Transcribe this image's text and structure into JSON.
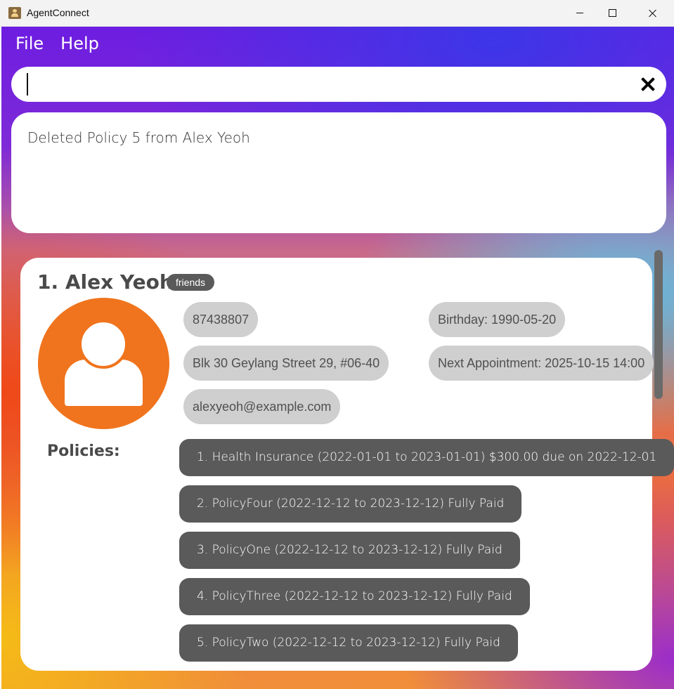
{
  "window": {
    "title": "AgentConnect",
    "icon": "address-book-icon"
  },
  "menu": {
    "items": [
      "File",
      "Help"
    ]
  },
  "command_box": {
    "value": "",
    "placeholder": ""
  },
  "result": {
    "text": "Deleted Policy 5 from Alex Yeoh"
  },
  "person": {
    "name": "1. Alex Yeoh",
    "tag": "friends",
    "phone": "87438807",
    "address": "Blk 30 Geylang Street 29, #06-40",
    "email": "alexyeoh@example.com",
    "birthday": "Birthday: 1990-05-20",
    "next_appointment": "Next Appointment: 2025-10-15 14:00",
    "policies_label": "Policies:",
    "policies": [
      "1. Health Insurance (2022-01-01 to 2023-01-01) $300.00 due on 2022-12-01",
      "2. PolicyFour (2022-12-12 to 2023-12-12) Fully Paid",
      "3. PolicyOne (2022-12-12 to 2023-12-12) Fully Paid",
      "4. PolicyThree (2022-12-12 to 2023-12-12) Fully Paid",
      "5. PolicyTwo (2022-12-12 to 2023-12-12) Fully Paid"
    ]
  },
  "colors": {
    "avatar": "#f0741d",
    "tag": "#5a5a5a",
    "field_pill": "#cfcfcf",
    "policy_pill": "#5a5a5a"
  }
}
